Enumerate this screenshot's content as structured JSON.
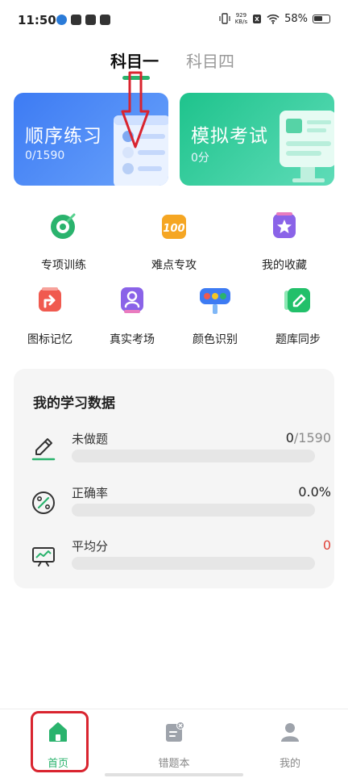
{
  "status_bar": {
    "time": "11:50",
    "net_speed_value": "929",
    "net_speed_unit": "KB/s",
    "battery": "58%"
  },
  "tabs": [
    {
      "label": "科目一",
      "active": true
    },
    {
      "label": "科目四",
      "active": false
    }
  ],
  "cards": {
    "practice": {
      "title": "顺序练习",
      "progress": "0/1590"
    },
    "exam": {
      "title": "模拟考试",
      "score": "0分"
    }
  },
  "grid": [
    {
      "label": "专项训练",
      "icon": "target-icon"
    },
    {
      "label": "难点专攻",
      "icon": "hundred-icon"
    },
    {
      "label": "我的收藏",
      "icon": "star-icon"
    },
    {
      "label": "图标记忆",
      "icon": "sign-arrow-icon"
    },
    {
      "label": "真实考场",
      "icon": "person-icon"
    },
    {
      "label": "颜色识别",
      "icon": "traffic-light-icon"
    },
    {
      "label": "题库同步",
      "icon": "edit-icon"
    }
  ],
  "stats": {
    "title": "我的学习数据",
    "undone": {
      "name": "未做题",
      "done": "0",
      "total": "/1590",
      "fraction": 0
    },
    "accuracy": {
      "name": "正确率",
      "value": "0.0%",
      "fraction": 0
    },
    "average": {
      "name": "平均分",
      "value": "0",
      "fraction": 0
    }
  },
  "nav": [
    {
      "label": "首页",
      "icon": "home-icon",
      "active": true
    },
    {
      "label": "错题本",
      "icon": "mistakes-book-icon",
      "active": false
    },
    {
      "label": "我的",
      "icon": "user-icon",
      "active": false
    }
  ],
  "colors": {
    "brand_green": "#2ab36d",
    "card_blue": "#3d7bf3",
    "card_green": "#1ec38c",
    "annotation_red": "#d9242f",
    "zero_red": "#e0433a"
  }
}
